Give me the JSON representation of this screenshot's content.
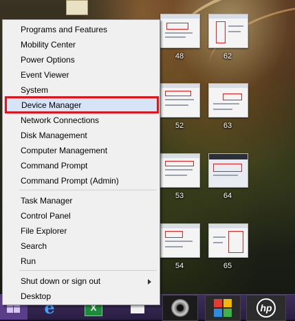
{
  "desktop": {
    "icons": [
      {
        "label": "48"
      },
      {
        "label": "62"
      },
      {
        "label": "52"
      },
      {
        "label": "63"
      },
      {
        "label": "53"
      },
      {
        "label": "64"
      },
      {
        "label": "54"
      },
      {
        "label": "65"
      }
    ]
  },
  "menu": {
    "group1": [
      {
        "label": "Programs and Features"
      },
      {
        "label": "Mobility Center"
      },
      {
        "label": "Power Options"
      },
      {
        "label": "Event Viewer"
      },
      {
        "label": "System"
      },
      {
        "label": "Device Manager"
      },
      {
        "label": "Network Connections"
      },
      {
        "label": "Disk Management"
      },
      {
        "label": "Computer Management"
      },
      {
        "label": "Command Prompt"
      },
      {
        "label": "Command Prompt (Admin)"
      }
    ],
    "group2": [
      {
        "label": "Task Manager"
      },
      {
        "label": "Control Panel"
      },
      {
        "label": "File Explorer"
      },
      {
        "label": "Search"
      },
      {
        "label": "Run"
      }
    ],
    "group3": [
      {
        "label": "Shut down or sign out"
      },
      {
        "label": "Desktop"
      }
    ],
    "selected": "Device Manager",
    "highlight_color": "#e2141b"
  },
  "taskbar": {
    "accent": "#2a1e43",
    "apps": [
      {
        "icon": "windows-start-icon"
      },
      {
        "icon": "internet-explorer-icon"
      },
      {
        "icon": "excel-icon"
      },
      {
        "icon": "store-icon"
      },
      {
        "icon": "camera-app-icon"
      },
      {
        "icon": "puzzle-app-icon"
      },
      {
        "icon": "hp-icon"
      }
    ]
  }
}
